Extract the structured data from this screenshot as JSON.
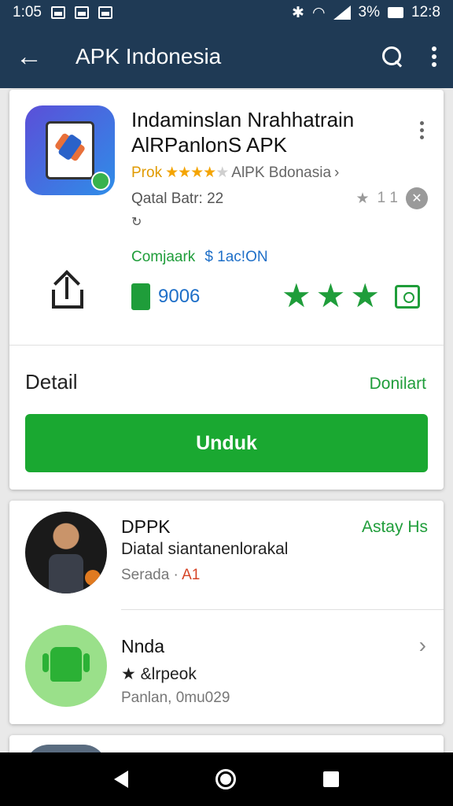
{
  "status_bar": {
    "time": "1:05",
    "battery": "3%",
    "clock_right": "12:8"
  },
  "app_bar": {
    "title": "APK Indonesia",
    "icons": [
      "back-arrow-icon",
      "search-icon",
      "more-vert-icon"
    ]
  },
  "app_card": {
    "name": "Indaminslan Nrahhatrain AlRPanlonS APK",
    "developer_prefix": "Prok",
    "developer": "AlPK Bdonasia",
    "size_text": "Qatal Batr: 22",
    "sub_text": "↻",
    "rating_text": "1 1",
    "link_green": "Comjaark",
    "link_blue": "$ 1ac!ON",
    "downloads": "9006",
    "detail_label": "Detail",
    "detail_link": "Donilart",
    "install_button": "Unduk",
    "colors": {
      "accent": "#1aa831",
      "header": "#1f3a55"
    }
  },
  "list": [
    {
      "title": "DPPK",
      "subtitle": "Diatal siantanenlorakal",
      "meta": "Serada ·",
      "meta_tag": "A1",
      "action": "Astay Hs"
    },
    {
      "title": "Nnda",
      "subtitle": "★ &lrpeok",
      "meta": "Panlan, 0mu029"
    }
  ]
}
